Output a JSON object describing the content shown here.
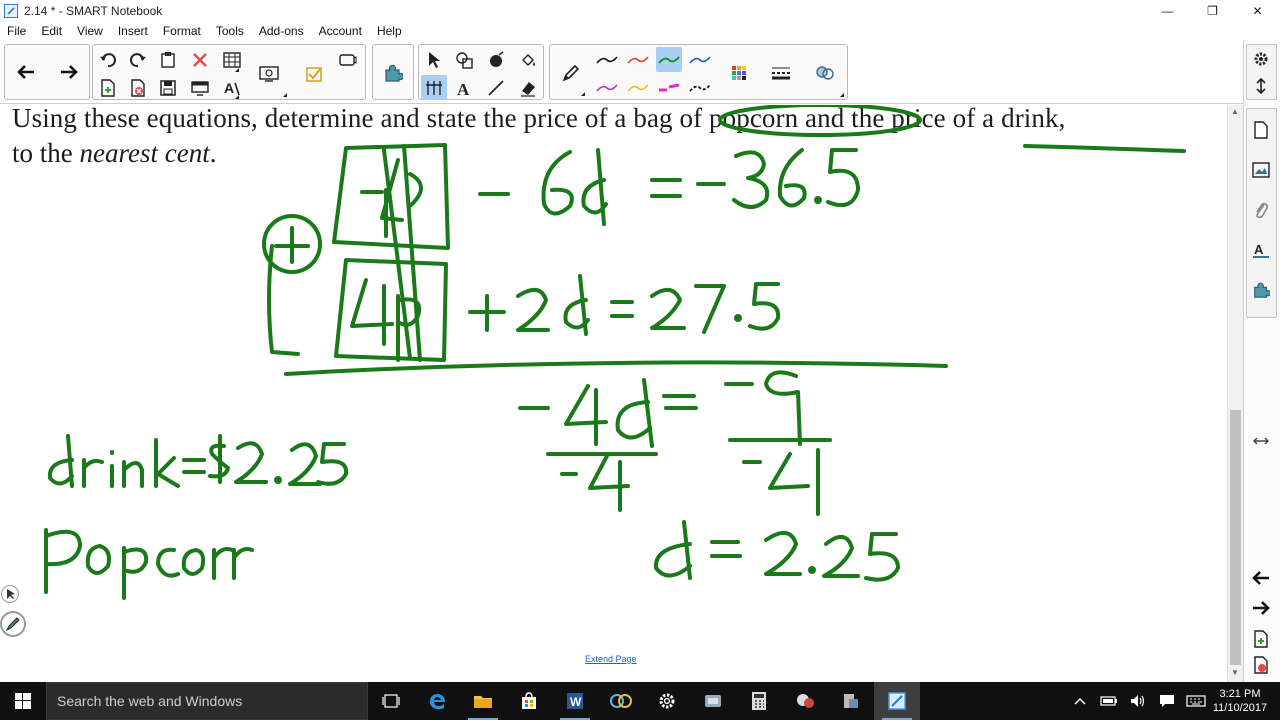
{
  "window": {
    "title": "2.14 * - SMART Notebook",
    "minimize": "—",
    "maximize": "❐",
    "close": "✕"
  },
  "menu": [
    "File",
    "Edit",
    "View",
    "Insert",
    "Format",
    "Tools",
    "Add-ons",
    "Account",
    "Help"
  ],
  "page": {
    "question_line1": "Using these equations, determine and state the price of a bag of popcorn and the price of a drink,",
    "question_line2_a": "to the ",
    "question_line2_em": "nearest cent",
    "question_line2_b": ".",
    "extend_page": "Extend Page"
  },
  "ink_color": "#1a7a1a",
  "highlight_color": "#a9cff2",
  "taskbar": {
    "search_placeholder": "Search the web and Windows",
    "time": "3:21 PM",
    "date": "11/10/2017"
  }
}
